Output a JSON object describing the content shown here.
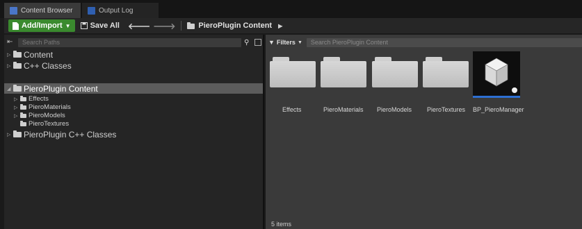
{
  "tabs": [
    {
      "label": "Content Browser",
      "icon": "content-browser-icon",
      "active": true
    },
    {
      "label": "Output Log",
      "icon": "output-log-icon",
      "active": false
    }
  ],
  "toolbar": {
    "add_import_label": "Add/Import",
    "save_all_label": "Save All",
    "breadcrumb": "PieroPlugin Content"
  },
  "sources": {
    "search_placeholder": "Search Paths",
    "tree": [
      {
        "label": "Content",
        "level": 0
      },
      {
        "label": "C++ Classes",
        "level": 0
      },
      {
        "label": "PieroPlugin Content",
        "level": 0,
        "selected": true
      },
      {
        "label": "Effects",
        "level": 1
      },
      {
        "label": "PieroMaterials",
        "level": 1
      },
      {
        "label": "PieroModels",
        "level": 1
      },
      {
        "label": "PieroTextures",
        "level": 1
      },
      {
        "label": "PieroPlugin C++ Classes",
        "level": 0
      }
    ]
  },
  "assets": {
    "filters_label": "Filters",
    "search_placeholder": "Search PieroPlugin Content",
    "items": [
      {
        "label": "Effects",
        "type": "folder"
      },
      {
        "label": "PieroMaterials",
        "type": "folder"
      },
      {
        "label": "PieroModels",
        "type": "folder"
      },
      {
        "label": "PieroTextures",
        "type": "folder"
      },
      {
        "label": "BP_PieroManager",
        "type": "blueprint"
      }
    ],
    "status": "5 items"
  },
  "colors": {
    "accent_green": "#3a8a2e",
    "selection_blue": "#2d6fd3"
  }
}
